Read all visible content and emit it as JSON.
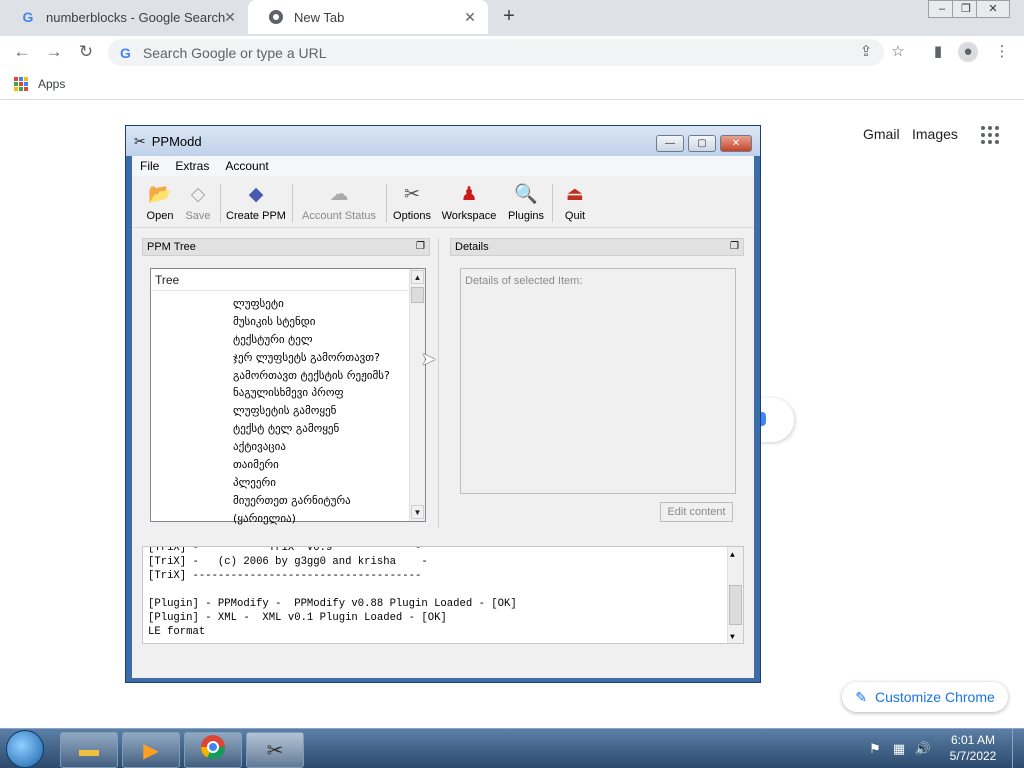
{
  "browser": {
    "tabs": [
      {
        "title": "numberblocks - Google Search",
        "favicon": "google-g-icon"
      },
      {
        "title": "New Tab",
        "favicon": "chrome-icon"
      }
    ],
    "new_tab_symbol": "+",
    "window_controls": [
      "–",
      "❐",
      "✕"
    ],
    "omnibox_placeholder": "Search Google or type a URL",
    "bookmarks": {
      "apps_label": "Apps"
    },
    "page_links": {
      "gmail": "Gmail",
      "images": "Images"
    },
    "customize_label": "Customize Chrome"
  },
  "ppm": {
    "title": "PPModd",
    "menus": [
      "File",
      "Extras",
      "Account"
    ],
    "toolbar": [
      {
        "label": "Open",
        "icon": "folder-icon",
        "enabled": true
      },
      {
        "label": "Save",
        "icon": "save-icon",
        "enabled": false
      },
      {
        "label": "Create PPM",
        "icon": "create-ppm-icon",
        "enabled": true
      },
      {
        "label": "Account Status",
        "icon": "account-status-icon",
        "enabled": false
      },
      {
        "label": "Options",
        "icon": "tools-icon",
        "enabled": true
      },
      {
        "label": "Workspace",
        "icon": "workspace-icon",
        "enabled": true
      },
      {
        "label": "Plugins",
        "icon": "magnifier-icon",
        "enabled": true
      },
      {
        "label": "Quit",
        "icon": "quit-icon",
        "enabled": true
      }
    ],
    "tree_panel_title": "PPM Tree",
    "tree_header": "Tree",
    "tree_items": [
      "ლუფსეტი",
      "მუსიკის სტენდი",
      "ტექსტური ტელ",
      "ჯერ ლუფსეტს გამორთავთ?",
      "გამორთავთ ტექსტის რეჟიმს?",
      "ნაგულისხმევი პროფ",
      "ლუფსეტის გამოყენ",
      "ტექსტ ტელ გამოყენ",
      "აქტივაცია",
      "თაიმერი",
      "პლეერი",
      "მიუერთეთ გარნიტურა",
      "(ყარიელია)"
    ],
    "details_panel_title": "Details",
    "details_label": "Details of selected Item:",
    "edit_button": "Edit content",
    "log_lines": [
      "[TriX] -           TriX  v0.9             -",
      "[TriX] -   (c) 2006 by g3gg0 and krisha    -",
      "[TriX] ------------------------------------",
      "",
      "[Plugin] - PPModify -  PPModify v0.88 Plugin Loaded - [OK]",
      "[Plugin] - XML -  XML v0.1 Plugin Loaded - [OK]",
      "LE format"
    ]
  },
  "taskbar": {
    "time": "6:01 AM",
    "date": "5/7/2022"
  }
}
